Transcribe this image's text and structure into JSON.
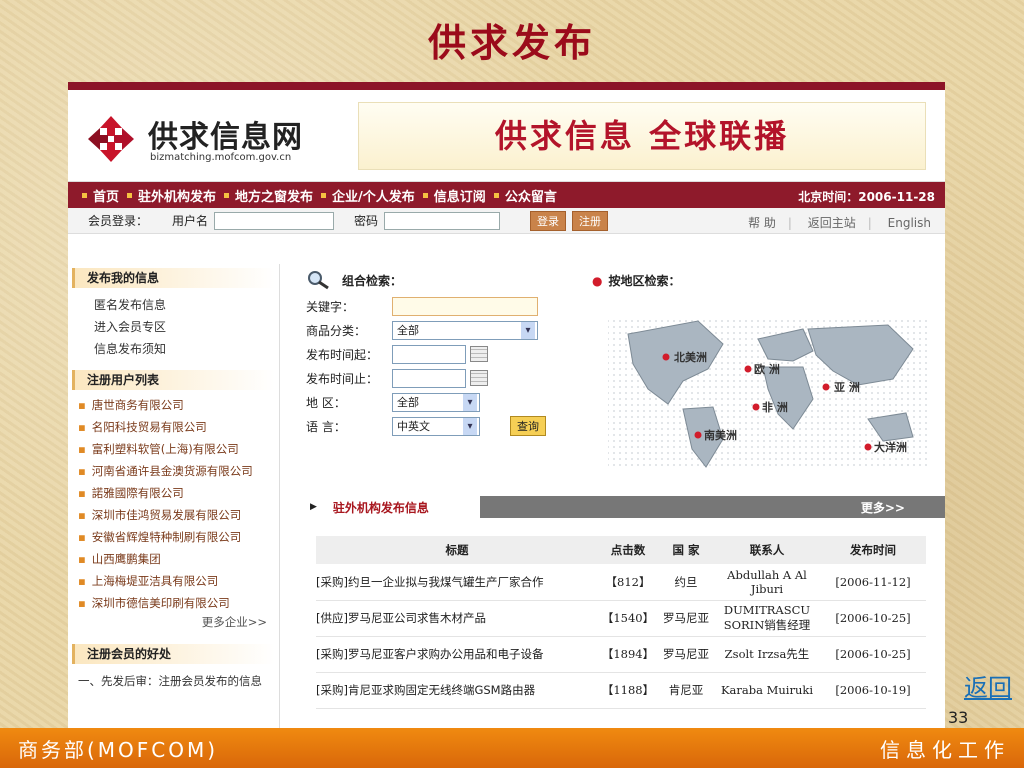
{
  "slide": {
    "title": "供求发布",
    "back_link": "返回",
    "page_number": "33",
    "footer_left": "商务部(MOFCOM)",
    "footer_right": "信息化工作"
  },
  "site": {
    "logo_name": "供求信息网",
    "logo_url": "bizmatching.mofcom.gov.cn",
    "banner": "供求信息 全球联播",
    "nav": [
      "首页",
      "驻外机构发布",
      "地方之窗发布",
      "企业/个人发布",
      "信息订阅",
      "公众留言"
    ],
    "date_label": "北京时间：2006-11-28"
  },
  "login": {
    "member_login": "会员登录：",
    "username_label": "用户名",
    "password_label": "密码",
    "login_button": "登录",
    "register_button": "注册",
    "links": [
      "帮 助",
      "返回主站",
      "English"
    ]
  },
  "sidebar": {
    "publish_title": "发布我的信息",
    "publish_links": [
      "匿名发布信息",
      "进入会员专区",
      "信息发布须知"
    ],
    "users_title": "注册用户列表",
    "users": [
      "唐世商务有限公司",
      "名阳科技贸易有限公司",
      "富利塑料软管(上海)有限公司",
      "河南省通许县金澳货源有限公司",
      "諾雅國際有限公司",
      "深圳市佳鸿贸易发展有限公司",
      "安徽省辉煌特种制刷有限公司",
      "山西鹰鹏集团",
      "上海梅堤亚洁具有限公司",
      "深圳市德信美印刷有限公司"
    ],
    "more_enterprises": "更多企业>>",
    "benefit_title": "注册会员的好处",
    "benefit_text": "一、先发后审：注册会员发布的信息"
  },
  "search": {
    "title": "组合检索：",
    "keyword_label": "关键字：",
    "category_label": "商品分类：",
    "category_value": "全部",
    "date_from_label": "发布时间起：",
    "date_to_label": "发布时间止：",
    "region_label": "地 区：",
    "region_value": "全部",
    "language_label": "语 言：",
    "language_value": "中英文",
    "query_button": "查询"
  },
  "map": {
    "title": "按地区检索：",
    "regions": [
      "北美洲",
      "欧 洲",
      "亚 洲",
      "非 洲",
      "南美洲",
      "大洋洲"
    ]
  },
  "recent": {
    "title": "驻外机构发布信息",
    "more": "更多>>",
    "headers": [
      "标题",
      "点击数",
      "国 家",
      "联系人",
      "发布时间"
    ],
    "rows": [
      [
        "[采购]约旦一企业拟与我煤气罐生产厂家合作",
        "【812】",
        "约旦",
        "Abdullah A Al Jiburi",
        "[2006-11-12]"
      ],
      [
        "[供应]罗马尼亚公司求售木材产品",
        "【1540】",
        "罗马尼亚",
        "DUMITRASCU SORIN销售经理",
        "[2006-10-25]"
      ],
      [
        "[采购]罗马尼亚客户求购办公用品和电子设备",
        "【1894】",
        "罗马尼亚",
        "Zsolt Irzsa先生",
        "[2006-10-25]"
      ],
      [
        "[采购]肯尼亚求购固定无线终端GSM路由器",
        "【1188】",
        "肯尼亚",
        "Karaba Muiruki",
        "[2006-10-19]"
      ]
    ]
  },
  "colors": {
    "accent": "#8e1a2b",
    "title_red": "#9b0b1b",
    "footer": "#e57a0c"
  }
}
